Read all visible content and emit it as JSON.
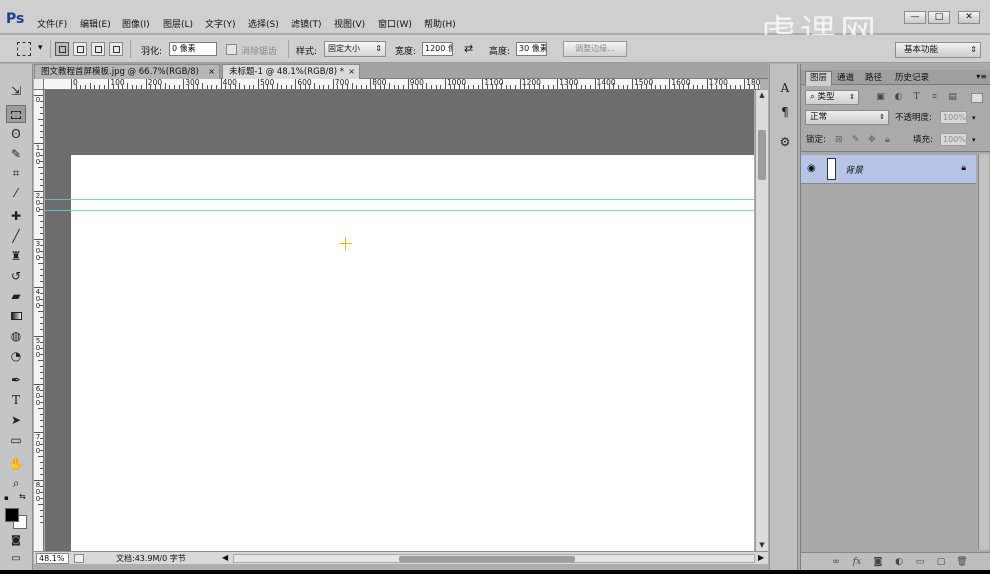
{
  "app": {
    "logo": "Ps"
  },
  "menu": [
    "文件(F)",
    "编辑(E)",
    "图像(I)",
    "图层(L)",
    "文字(Y)",
    "选择(S)",
    "滤镜(T)",
    "视图(V)",
    "窗口(W)",
    "帮助(H)"
  ],
  "window_controls": {
    "minimize": "—",
    "maximize": "□",
    "close": "✕"
  },
  "watermark": "虎课网",
  "options": {
    "feather_label": "羽化:",
    "feather_value": "0 像素",
    "antialias_label": "消除锯齿",
    "style_label": "样式:",
    "style_value": "固定大小",
    "width_label": "宽度:",
    "width_value": "1200 像",
    "height_label": "高度:",
    "height_value": "30 像素",
    "refine_edge": "调整边缘..."
  },
  "workspace": {
    "label": "基本功能"
  },
  "tabs": [
    {
      "label": "图文教程首屏模板.jpg @ 66.7%(RGB/8)",
      "close": "×"
    },
    {
      "label": "未标题-1 @ 48.1%(RGB/8) *",
      "close": "×"
    }
  ],
  "ruler_h_labels": [
    "0",
    "100",
    "200",
    "300",
    "400",
    "500",
    "600",
    "700",
    "800",
    "900",
    "1000",
    "1100",
    "1200",
    "1300",
    "1400",
    "1500",
    "1600",
    "1700",
    "180"
  ],
  "ruler_v_labels": [
    "0",
    "1 0 0",
    "2 0 0",
    "3 0 0",
    "4 0 0",
    "5 0 0",
    "6 0 0",
    "7 0 0",
    "8 0 0"
  ],
  "status": {
    "zoom": "48.1%",
    "doc_info": "文档:43.9M/0 字节"
  },
  "layers_panel": {
    "tabs": [
      "图层",
      "通道",
      "路径",
      "历史记录"
    ],
    "filter_kind": "类型",
    "blend_mode": "正常",
    "opacity_label": "不透明度:",
    "opacity_value": "100%",
    "lock_label": "锁定:",
    "fill_label": "填充:",
    "fill_value": "100%",
    "layer_name": "背景"
  },
  "colors": {
    "accent": "#1f3e8f",
    "guide": "#59d0d9",
    "selected_layer": "#b6c4e6"
  }
}
